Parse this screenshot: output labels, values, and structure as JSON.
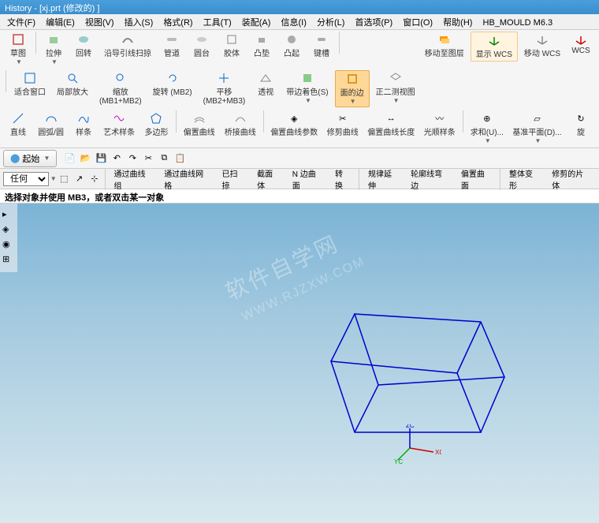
{
  "title": "History - [xj.prt (修改的) ]",
  "menu": {
    "file": "文件(F)",
    "edit": "编辑(E)",
    "view": "视图(V)",
    "insert": "插入(S)",
    "format": "格式(R)",
    "tools": "工具(T)",
    "assembly": "装配(A)",
    "info": "信息(I)",
    "analysis": "分析(L)",
    "prefs": "首选项(P)",
    "window": "窗口(O)",
    "help": "帮助(H)",
    "hbmould": "HB_MOULD M6.3"
  },
  "row1": {
    "sketch": "草图",
    "extrude": "拉伸",
    "revolve": "回转",
    "guide_sweep": "沿导引线扫掠",
    "tube": "管道",
    "disk": "圆台",
    "shell": "胶体",
    "pad": "凸垫",
    "boss": "凸起",
    "keyslot": "键槽",
    "move_layer": "移动至图层",
    "show_wcs": "显示 WCS",
    "move_wcs": "移动 WCS",
    "wcs": "WCS"
  },
  "row2": {
    "fit_window": "适合窗口",
    "local_zoom": "局部放大",
    "zoom": "缩放",
    "zoom_sub": "(MB1+MB2)",
    "rotate": "旋转 (MB2)",
    "pan": "平移",
    "pan_sub": "(MB2+MB3)",
    "persp": "透视",
    "edge_color": "带边着色(S)",
    "face_edge": "面的边",
    "trimetric": "正二测视图"
  },
  "row2b": {
    "line": "直线",
    "arc": "圆弧/圆",
    "spline": "样条",
    "art_spline": "艺术样条",
    "polygon": "多边形",
    "edit_curve": "偏置曲线",
    "bridge_curve": "桥接曲线",
    "edit_curve_param": "偏置曲线参数",
    "trim_curve": "修剪曲线",
    "curve_length": "偏置曲线长度",
    "smooth_spline": "光顺样条",
    "sum": "求和(U)...",
    "datum_plane": "基准平面(D)...",
    "rotate2": "旋"
  },
  "row3": {
    "start": "起始"
  },
  "row4": {
    "any": "任何",
    "through_curves": "通过曲线组",
    "through_mesh": "通过曲线网格",
    "swept": "已扫掠",
    "section": "截面体",
    "n_surface": "N 边曲面",
    "convert": "转换",
    "extend": "规律延伸",
    "wheel_bend": "轮廓线弯边",
    "offset_surf": "偏置曲面",
    "global_deform": "整体变形",
    "trim_sheet": "修剪的片体"
  },
  "status_text": "选择对象并使用 MB3，或者双击某一对象",
  "watermark": "软件自学网",
  "watermark_url": "WWW.RJZXW.COM",
  "axis": {
    "xc": "XC",
    "yc": "YC",
    "zc": "ZC"
  }
}
